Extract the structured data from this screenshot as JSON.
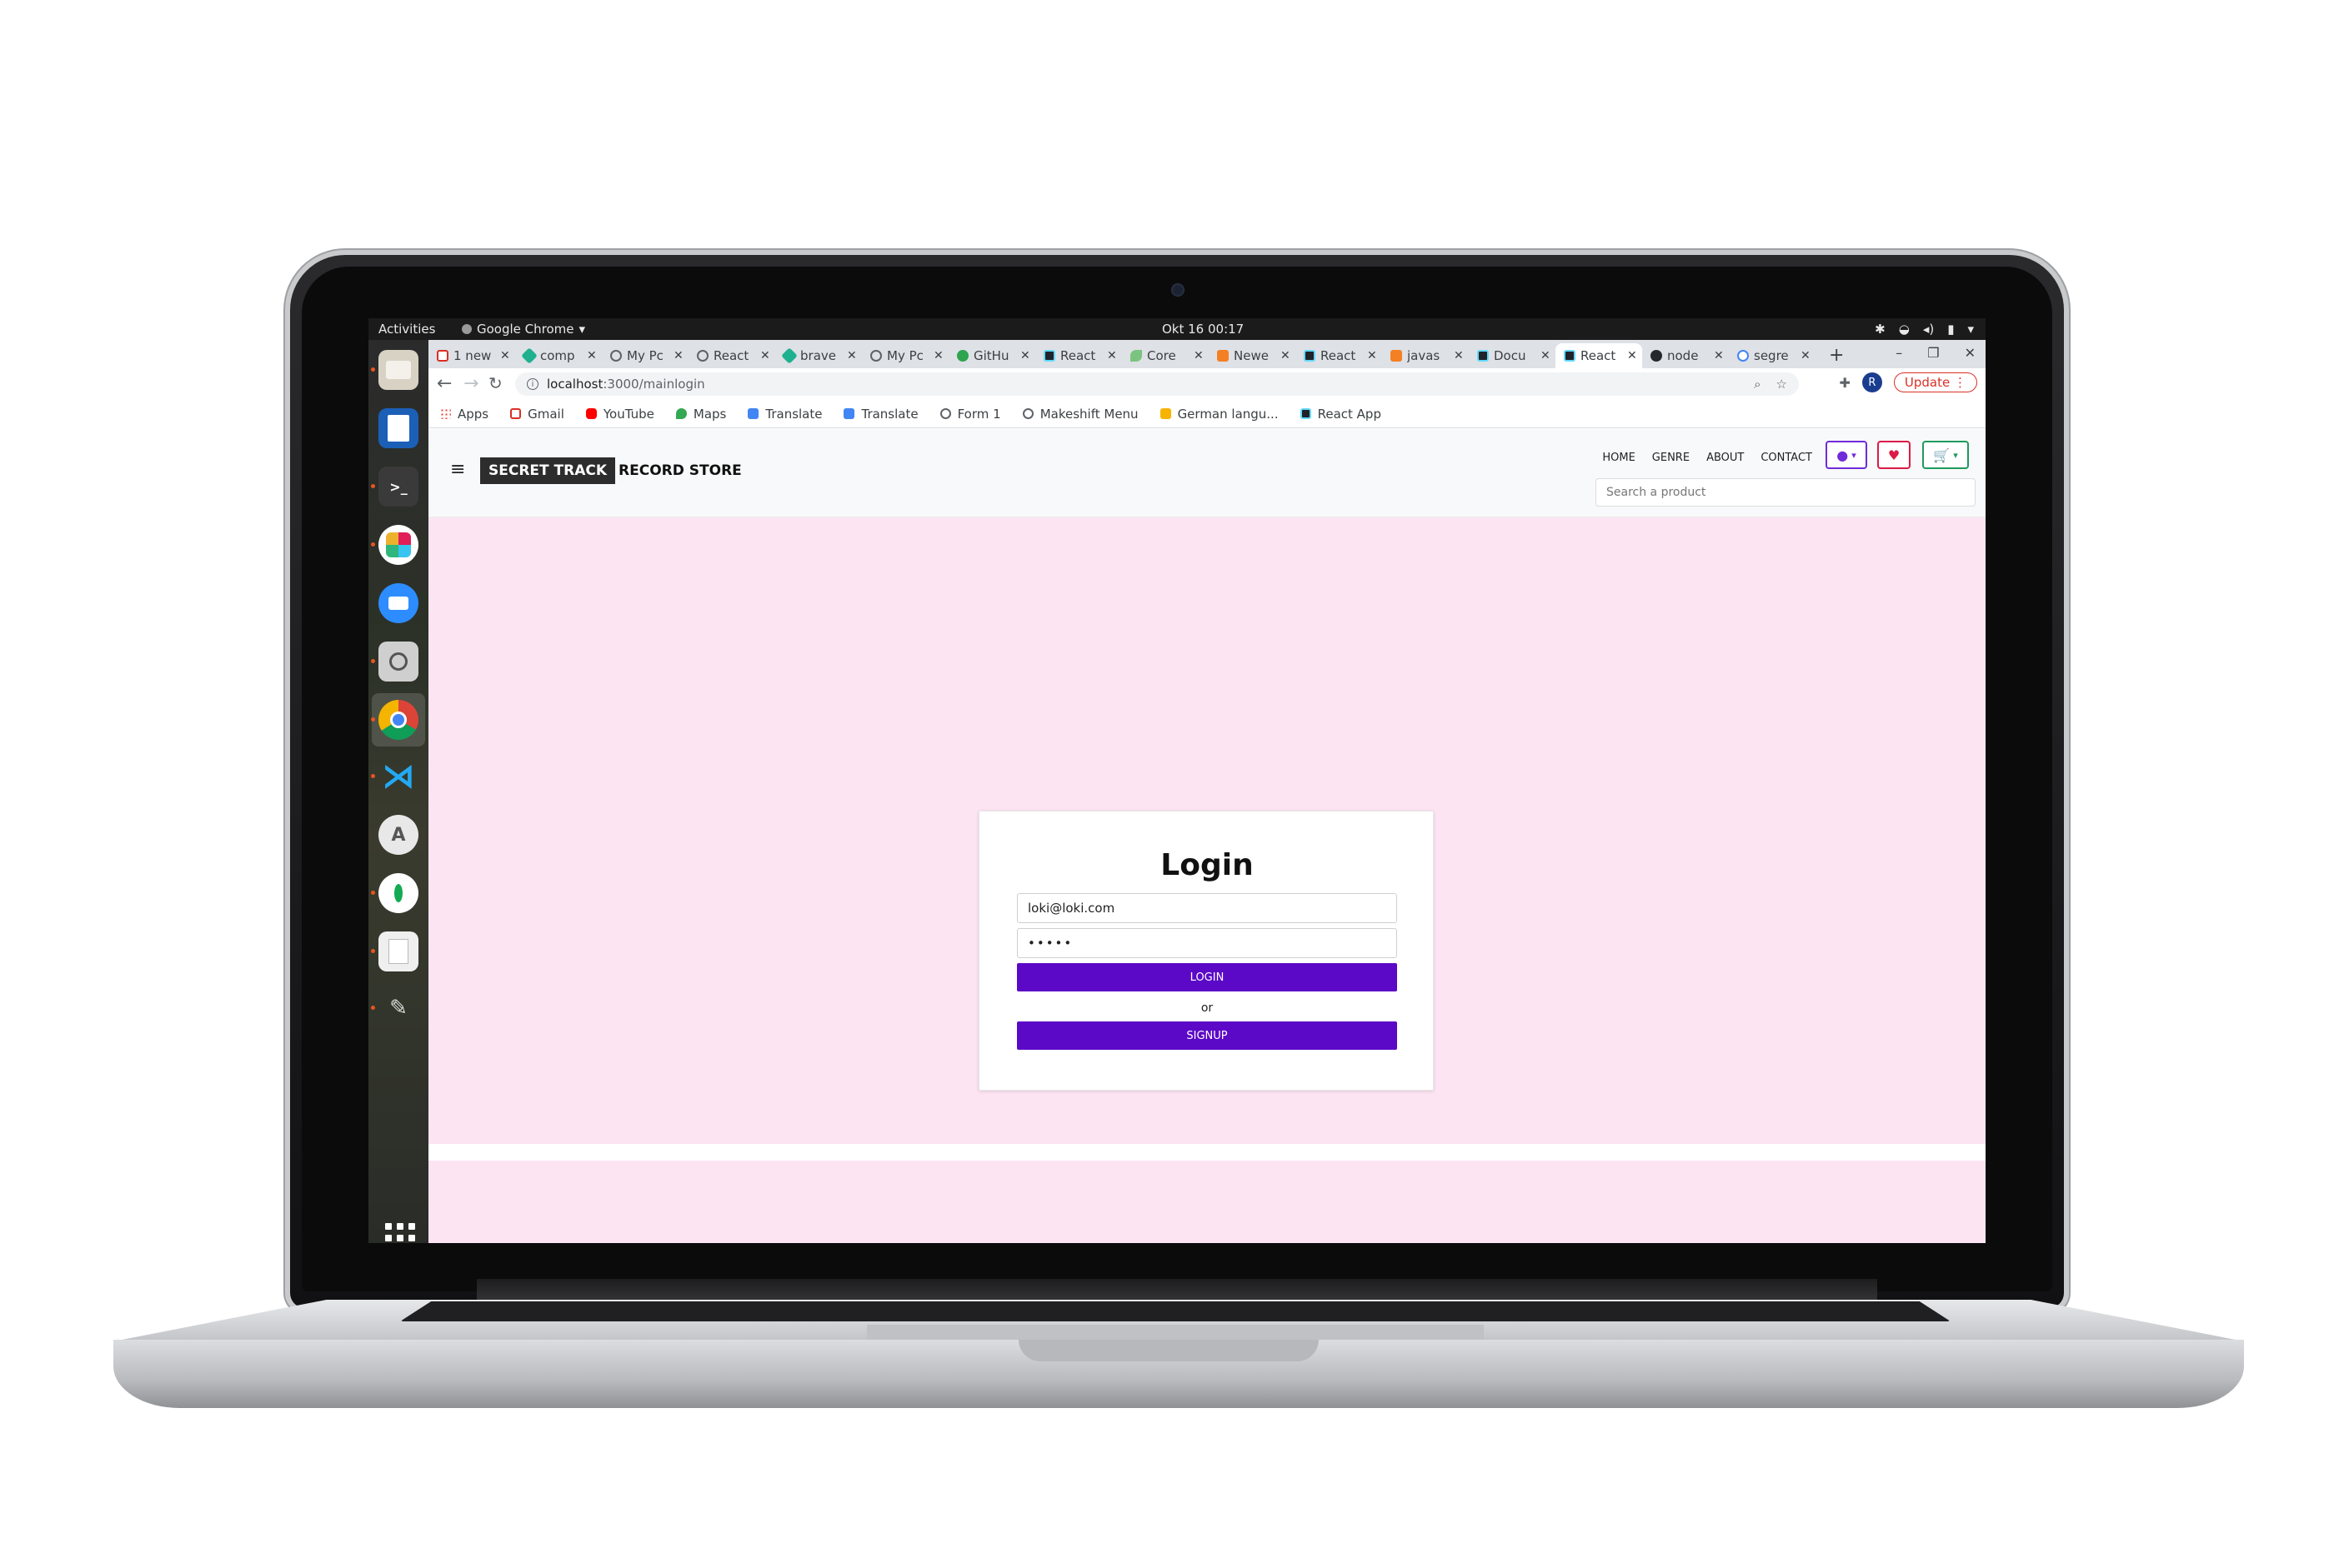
{
  "os_topbar": {
    "activities": "Activities",
    "app_name": "Google Chrome",
    "clock": "Okt 16  00:17"
  },
  "dock": {
    "apps": [
      "files",
      "writer",
      "terminal",
      "slack",
      "zoom",
      "image-viewer",
      "chrome",
      "vscode",
      "software-center",
      "mongodb-compass",
      "document-viewer",
      "gimp"
    ],
    "colors": {
      "ubuntu_orange": "#e95420"
    }
  },
  "browser": {
    "tabs": [
      {
        "label": "1 new",
        "icon": "gmail-icon"
      },
      {
        "label": "comp",
        "icon": "diamond-icon"
      },
      {
        "label": "My Pc",
        "icon": "globe-icon"
      },
      {
        "label": "React",
        "icon": "globe-icon"
      },
      {
        "label": "brave",
        "icon": "diamond-icon"
      },
      {
        "label": "My Pc",
        "icon": "globe-icon"
      },
      {
        "label": "GitHu",
        "icon": "github-icon"
      },
      {
        "label": "React",
        "icon": "react-icon"
      },
      {
        "label": "Core",
        "icon": "leaf-icon"
      },
      {
        "label": "Newe",
        "icon": "stackoverflow-icon"
      },
      {
        "label": "React",
        "icon": "react-icon"
      },
      {
        "label": "javas",
        "icon": "stackoverflow-icon"
      },
      {
        "label": "Docu",
        "icon": "react-icon"
      },
      {
        "label": "React",
        "icon": "react-icon",
        "active": true
      },
      {
        "label": "node",
        "icon": "github-icon"
      },
      {
        "label": "segre",
        "icon": "google-icon"
      }
    ],
    "url_host": "localhost",
    "url_path": ":3000/mainlogin",
    "profile_initial": "R",
    "update_label": "Update",
    "bookmarks": [
      {
        "label": "Apps",
        "icon": "apps-grid-icon"
      },
      {
        "label": "Gmail",
        "icon": "gmail-icon"
      },
      {
        "label": "YouTube",
        "icon": "youtube-icon"
      },
      {
        "label": "Maps",
        "icon": "maps-pin-icon"
      },
      {
        "label": "Translate",
        "icon": "translate-icon"
      },
      {
        "label": "Translate",
        "icon": "translate-icon"
      },
      {
        "label": "Form 1",
        "icon": "globe-icon"
      },
      {
        "label": "Makeshift Menu",
        "icon": "globe-icon"
      },
      {
        "label": "German langu...",
        "icon": "folder-icon"
      },
      {
        "label": "React App",
        "icon": "react-icon"
      }
    ]
  },
  "site": {
    "brand_dark": "SECRET TRACK",
    "brand_light": "RECORD STORE",
    "nav": [
      "HOME",
      "GENRE",
      "ABOUT",
      "CONTACT"
    ],
    "search_placeholder": "Search a product",
    "colors": {
      "page_bg": "#fde4f2",
      "primary": "#5b09c7",
      "user_btn": "#6f2bd9",
      "fav_btn": "#dc1a45",
      "cart_btn": "#1e9a5c"
    }
  },
  "login": {
    "title": "Login",
    "email_value": "loki@loki.com",
    "password_value": "•••••",
    "login_button": "LOGIN",
    "or_text": "or",
    "signup_button": "SIGNUP"
  }
}
